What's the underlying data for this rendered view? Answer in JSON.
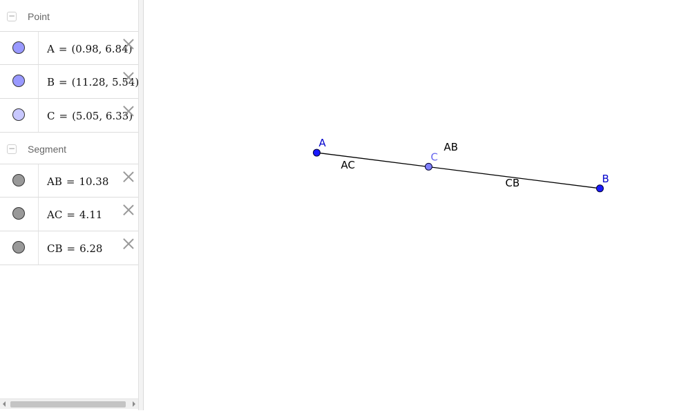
{
  "algebra": {
    "groups": [
      {
        "label": "Point",
        "collapse_symbol": "−",
        "rows": [
          {
            "name": "A",
            "value": "(0.98, 6.84)",
            "color": "#9999ff"
          },
          {
            "name": "B",
            "value": "(11.28, 5.54)",
            "color": "#9999ff"
          },
          {
            "name": "C",
            "value": "(5.05, 6.33)",
            "color": "#c8c8ff"
          }
        ]
      },
      {
        "label": "Segment",
        "collapse_symbol": "−",
        "rows": [
          {
            "name": "AB",
            "value": "10.38",
            "color": "#999999"
          },
          {
            "name": "AC",
            "value": "4.11",
            "color": "#999999"
          },
          {
            "name": "CB",
            "value": "6.28",
            "color": "#999999"
          }
        ]
      }
    ],
    "equals_sign": "="
  },
  "graphics": {
    "points": [
      {
        "id": "A",
        "label": "A",
        "x": 0.98,
        "y": 6.84,
        "fill": "#1a1aff",
        "label_color": "#0000cc"
      },
      {
        "id": "B",
        "label": "B",
        "x": 11.28,
        "y": 5.54,
        "fill": "#1a1aff",
        "label_color": "#0000cc"
      },
      {
        "id": "C",
        "label": "C",
        "x": 5.05,
        "y": 6.33,
        "fill": "#8080ff",
        "label_color": "#6666ee"
      }
    ],
    "segments": [
      {
        "id": "AB",
        "label": "AB",
        "from": "A",
        "to": "B"
      },
      {
        "id": "AC",
        "label": "AC",
        "from": "A",
        "to": "C"
      },
      {
        "id": "CB",
        "label": "CB",
        "from": "C",
        "to": "B"
      }
    ],
    "segment_color": "#000000"
  }
}
